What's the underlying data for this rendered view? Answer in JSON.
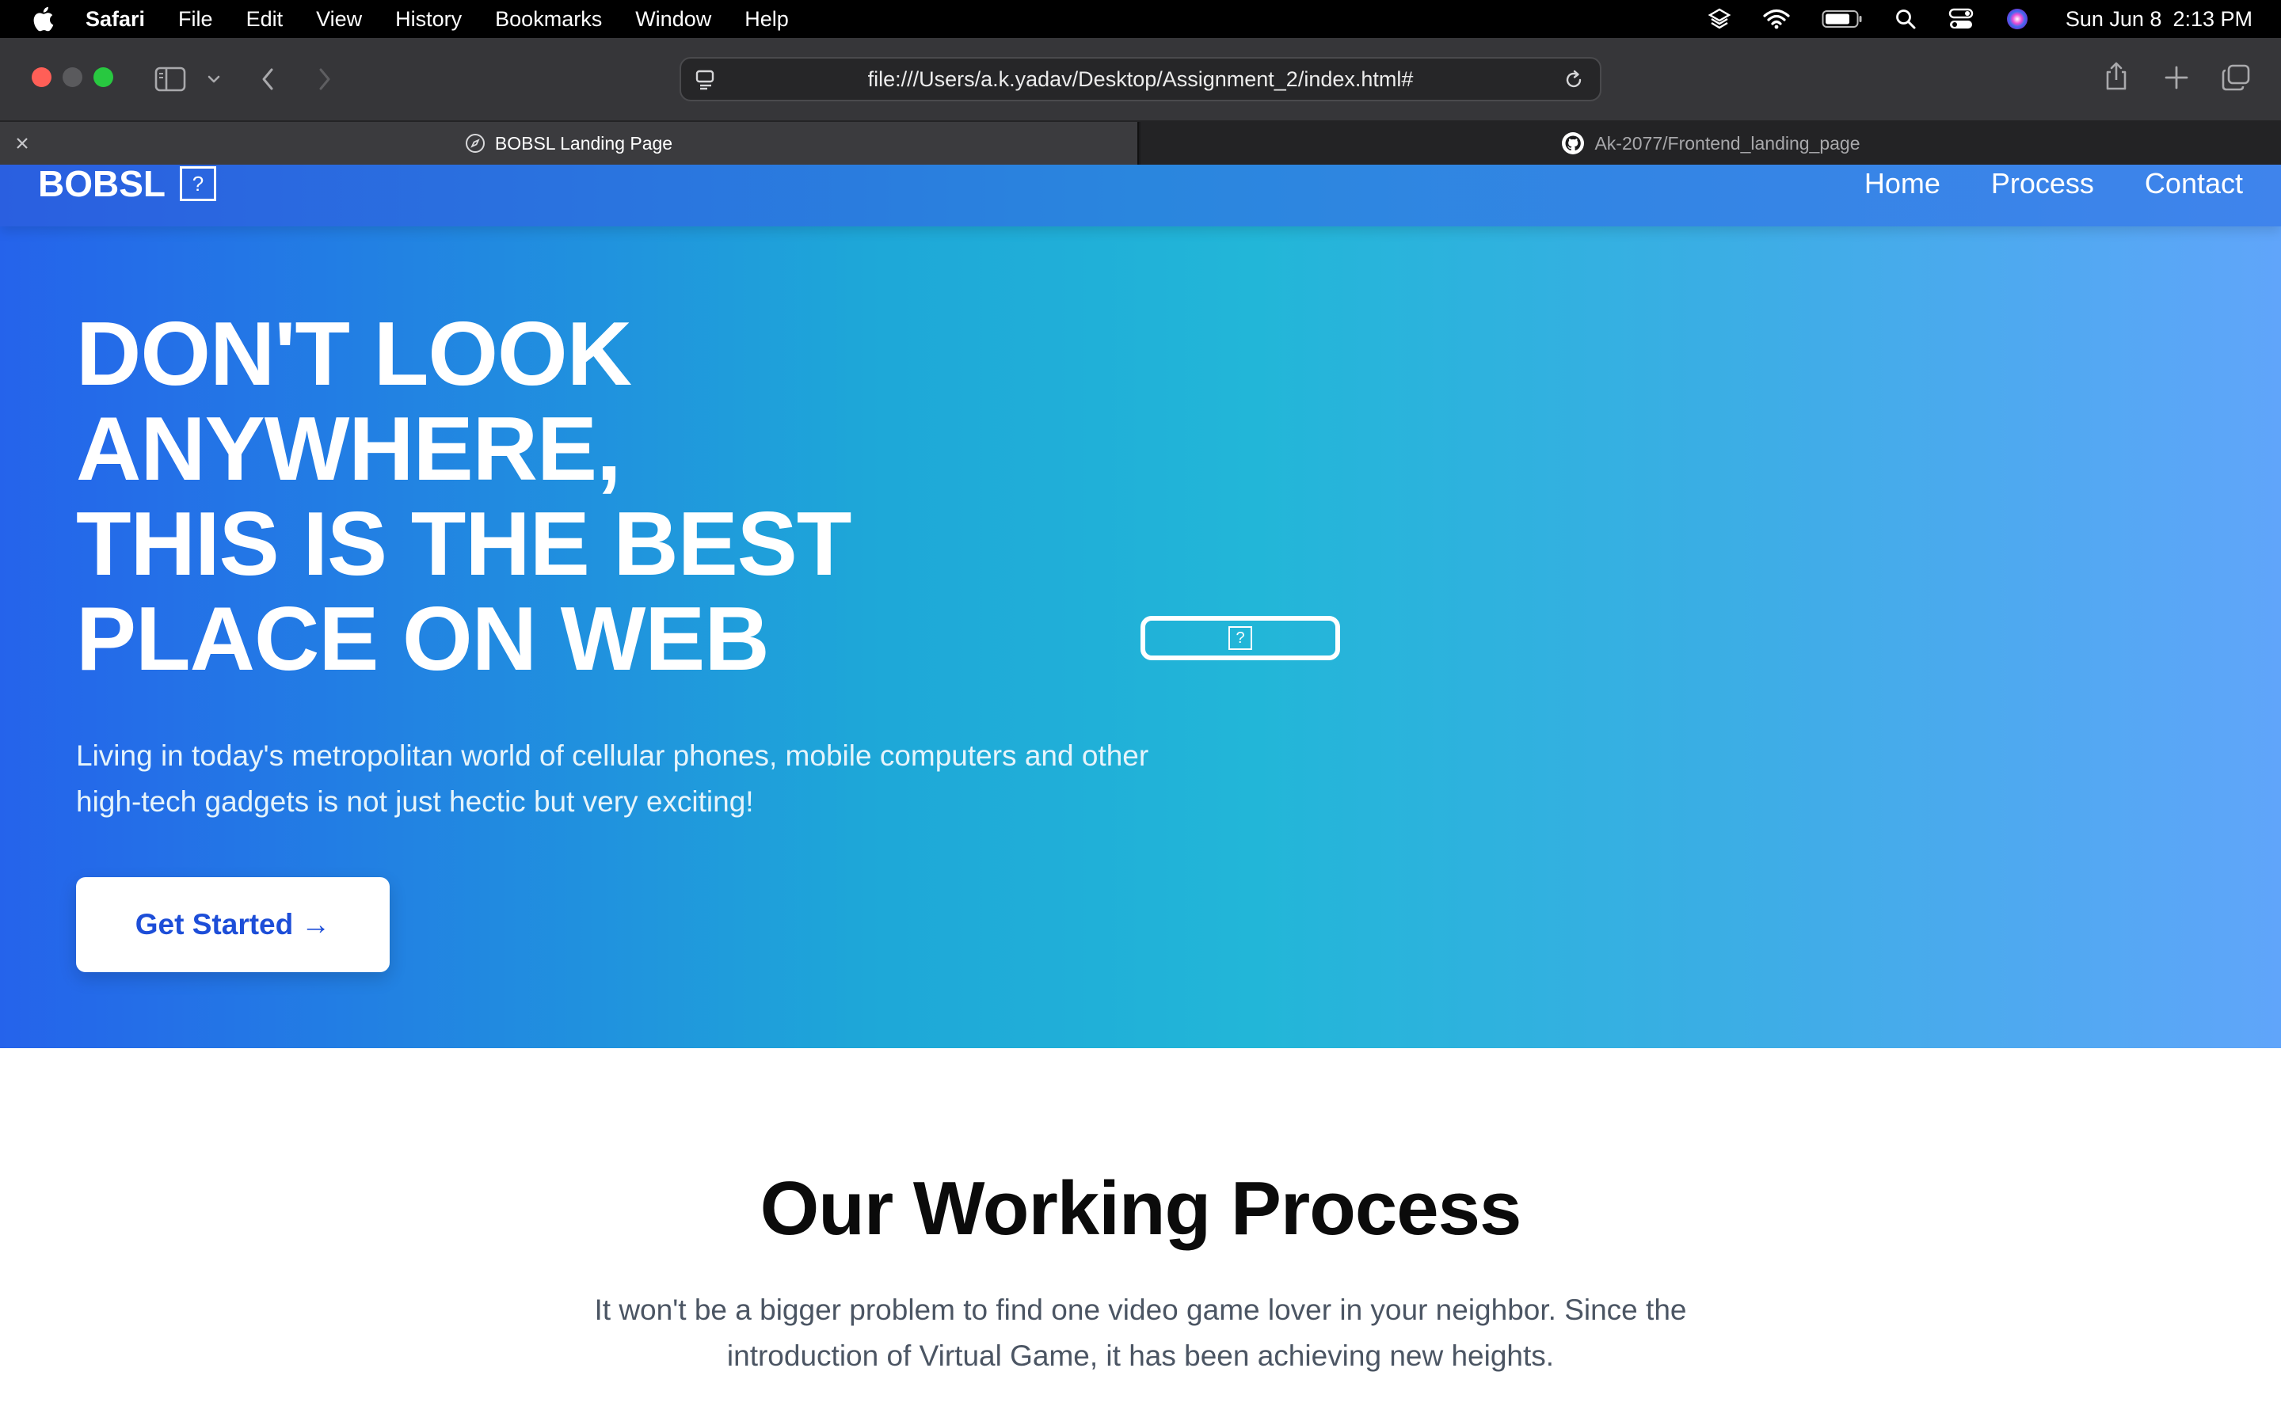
{
  "menubar": {
    "app_name": "Safari",
    "items": [
      "File",
      "Edit",
      "View",
      "History",
      "Bookmarks",
      "Window",
      "Help"
    ],
    "date": "Sun Jun 8",
    "time": "2:13 PM",
    "status_icons": [
      "layers-icon",
      "wifi-icon",
      "battery-icon",
      "search-icon",
      "control-center-icon",
      "siri-icon"
    ]
  },
  "toolbar": {
    "url": "file:///Users/a.k.yadav/Desktop/Assignment_2/index.html#",
    "traffic_colors": [
      "#ff5f57",
      "#5a5a5d",
      "#28c840"
    ]
  },
  "tabs": [
    {
      "title": "BOBSL Landing Page",
      "active": true,
      "icon": "compass-icon"
    },
    {
      "title": "Ak-2077/Frontend_landing_page",
      "active": false,
      "icon": "github-icon"
    }
  ],
  "page": {
    "brand": "BOBSL",
    "brand_icon_glyph": "?",
    "nav": [
      "Home",
      "Process",
      "Contact"
    ],
    "headline": [
      "DON'T LOOK",
      "ANYWHERE,",
      "THIS IS THE BEST",
      "PLACE ON WEB"
    ],
    "hero_description": "Living in today's metropolitan world of cellular phones, mobile computers and other high-tech gadgets is not just hectic but very exciting!",
    "cta_label": "Get Started",
    "cta_arrow": "→",
    "hero_image_glyph": "?",
    "process_title": "Our Working Process",
    "process_description": "It won't be a bigger problem to find one video game lover in your neighbor. Since the introduction of Virtual Game, it has been achieving new heights."
  },
  "colors": {
    "hero_gradient": [
      "#2563eb",
      "#22b6d8",
      "#60a5fa"
    ],
    "cta_text": "#1d4ed8"
  }
}
